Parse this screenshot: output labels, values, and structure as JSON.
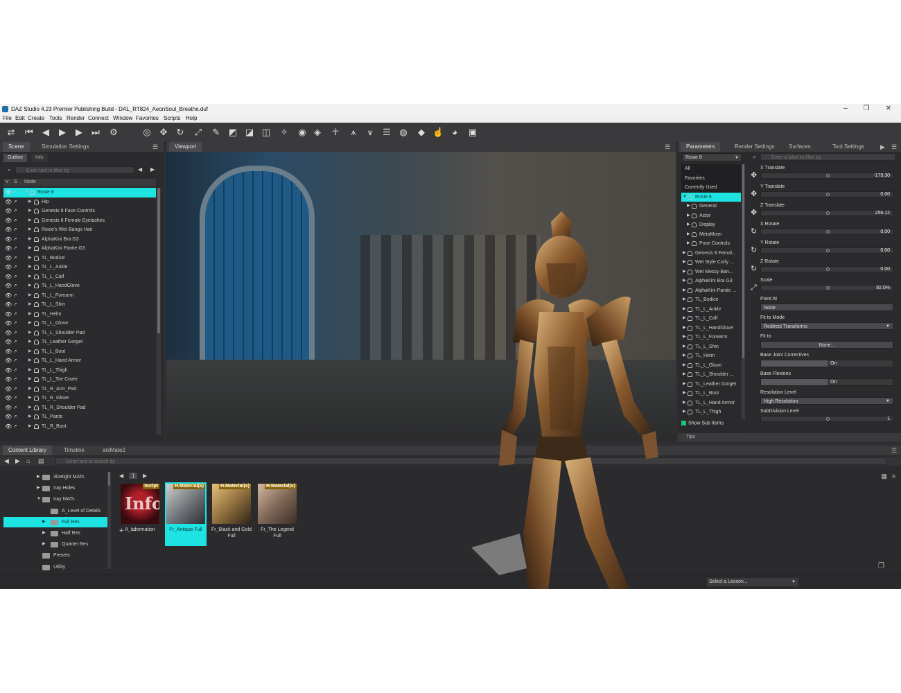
{
  "window": {
    "title": "DAZ Studio 4.23 Premier Publishing Build - DAL_RT824_AeonSoul_Breathe.duf",
    "controls": [
      "–",
      "❐",
      "✕"
    ]
  },
  "menu": [
    "File",
    "Edit",
    "Create",
    "Tools",
    "Render",
    "Connect",
    "Window",
    "Favorites",
    "Scripts",
    "Help"
  ],
  "toolbar": {
    "icons": [
      "undo-redo-icon",
      "skip-start-icon",
      "step-back-icon",
      "play-icon",
      "step-forward-icon",
      "skip-end-icon",
      "node-selection-icon",
      "universal-tool-icon",
      "translate-icon",
      "rotate-icon",
      "scale-icon",
      "joint-editor-icon",
      "geometry-editor-icon",
      "surface-selection-icon",
      "region-navigator-icon",
      "active-pose-icon",
      "camera-icon",
      "render-icon",
      "figure-icon",
      "morph-icon",
      "morph-alt-icon",
      "list-icon",
      "spot-render-icon",
      "iray-icon",
      "pointer-icon",
      "sphere-icon",
      "cube-icon"
    ]
  },
  "scene": {
    "tabs": [
      "Scene",
      "Simulation Settings"
    ],
    "subtabs": [
      "Outline",
      "Info"
    ],
    "filter_placeholder": "Enter text to filter by",
    "header": {
      "v": "V",
      "s": "S",
      "node": "Node"
    },
    "rows": [
      {
        "label": "Rosie 8",
        "level": 0,
        "selected": true
      },
      {
        "label": "Hip",
        "level": 1
      },
      {
        "label": "Genesis 8 Face Controls",
        "level": 1
      },
      {
        "label": "Genesis 8 Female Eyelashes",
        "level": 1
      },
      {
        "label": "Rosie's Wet Bangs Hair",
        "level": 1
      },
      {
        "label": "AlphaKini Bra G3",
        "level": 1
      },
      {
        "label": "AlphaKini Pantie G3",
        "level": 1
      },
      {
        "label": "TL_Bodice",
        "level": 1
      },
      {
        "label": "TL_L_Ankle",
        "level": 1
      },
      {
        "label": "TL_L_Calf",
        "level": 1
      },
      {
        "label": "TL_L_HandGlove",
        "level": 1
      },
      {
        "label": "TL_L_Forearm",
        "level": 1
      },
      {
        "label": "TL_L_Shin",
        "level": 1
      },
      {
        "label": "TL_Helm",
        "level": 1
      },
      {
        "label": "TL_L_Glove",
        "level": 1
      },
      {
        "label": "TL_L_Shoulder Pad",
        "level": 1
      },
      {
        "label": "TL_Leather Gorget",
        "level": 1
      },
      {
        "label": "TL_L_Boot",
        "level": 1
      },
      {
        "label": "TL_L_Hand Armor",
        "level": 1
      },
      {
        "label": "TL_L_Thigh",
        "level": 1
      },
      {
        "label": "TL_L_Toe Cover",
        "level": 1
      },
      {
        "label": "TL_R_Arm_Pad",
        "level": 1
      },
      {
        "label": "TL_R_Glove",
        "level": 1
      },
      {
        "label": "TL_R_Shoulder Pad",
        "level": 1
      },
      {
        "label": "TL_Pants",
        "level": 1
      },
      {
        "label": "TL_R_Boot",
        "level": 1
      }
    ]
  },
  "viewport": {
    "tab": "Viewport"
  },
  "parameters": {
    "tabs": [
      "Parameters",
      "Render Settings",
      "Surfaces",
      "Tool Settings"
    ],
    "node_select": "Rosie 8",
    "filter_placeholder": "Enter a label to filter by",
    "tree": [
      {
        "label": "All",
        "type": "cat"
      },
      {
        "label": "Favorites",
        "type": "cat"
      },
      {
        "label": "Currently Used",
        "type": "cat"
      },
      {
        "label": "Rosie 8",
        "type": "node",
        "selected": true,
        "level": 0
      },
      {
        "label": "General",
        "level": 1
      },
      {
        "label": "Actor",
        "level": 1
      },
      {
        "label": "Display",
        "level": 1
      },
      {
        "label": "MetaMixer",
        "level": 1
      },
      {
        "label": "Pose Controls",
        "level": 1
      },
      {
        "label": "Genesis 8 Femal...",
        "level": 0
      },
      {
        "label": "Wet Style Curly ...",
        "level": 0
      },
      {
        "label": "Wet Messy Ban...",
        "level": 0
      },
      {
        "label": "AlphaKini Bra G3",
        "level": 0
      },
      {
        "label": "AlphaKini Pantie ...",
        "level": 0
      },
      {
        "label": "TL_Bodice",
        "level": 0
      },
      {
        "label": "TL_L_Ankle",
        "level": 0
      },
      {
        "label": "TL_L_Calf",
        "level": 0
      },
      {
        "label": "TL_L_HandGlove",
        "level": 0
      },
      {
        "label": "TL_L_Forearm",
        "level": 0
      },
      {
        "label": "TL_L_Shin",
        "level": 0
      },
      {
        "label": "TL_Helm",
        "level": 0
      },
      {
        "label": "TL_L_Glove",
        "level": 0
      },
      {
        "label": "TL_L_Shoulder ...",
        "level": 0
      },
      {
        "label": "TL_Leather Gorget",
        "level": 0
      },
      {
        "label": "TL_L_Boot",
        "level": 0
      },
      {
        "label": "TL_L_Hand Armor",
        "level": 0
      },
      {
        "label": "TL_L_Thigh",
        "level": 0
      }
    ],
    "show_sub_items": "Show Sub Items",
    "properties": [
      {
        "label": "X Translate",
        "kind": "slider",
        "value": "-179.30",
        "icon": "translate"
      },
      {
        "label": "Y Translate",
        "kind": "slider",
        "value": "0.00",
        "icon": "translate"
      },
      {
        "label": "Z Translate",
        "kind": "slider",
        "value": "256.12",
        "icon": "translate"
      },
      {
        "label": "X Rotate",
        "kind": "slider",
        "value": "0.00",
        "icon": "rotate"
      },
      {
        "label": "Y Rotate",
        "kind": "slider",
        "value": "0.00",
        "icon": "rotate"
      },
      {
        "label": "Z Rotate",
        "kind": "slider",
        "value": "0.00",
        "icon": "rotate"
      },
      {
        "label": "Scale",
        "kind": "slider",
        "value": "92.0%",
        "icon": "scale"
      },
      {
        "label": "Point At",
        "kind": "field",
        "value": "None"
      },
      {
        "label": "Fit to Mode",
        "kind": "dropdown",
        "value": "Redirect Transforms"
      },
      {
        "label": "Fit to",
        "kind": "button",
        "value": "None..."
      },
      {
        "label": "Base Joint Correctives",
        "kind": "toggle",
        "value": "On"
      },
      {
        "label": "Base Flexions",
        "kind": "toggle",
        "value": "On"
      },
      {
        "label": "Resolution Level",
        "kind": "dropdown",
        "value": "High Resolution"
      },
      {
        "label": "SubDivision Level",
        "kind": "slider",
        "value": "1"
      }
    ],
    "tips": "Tips"
  },
  "content": {
    "tabs": [
      "Content Library",
      "Timeline",
      "aniMate2"
    ],
    "search_placeholder": "Enter text to search by",
    "tree": [
      {
        "label": "3Delight MATs",
        "indent": 1,
        "arrow": "▶"
      },
      {
        "label": "Iray Hides",
        "indent": 1,
        "arrow": "▶"
      },
      {
        "label": "Iray MATs",
        "indent": 1,
        "arrow": "▼"
      },
      {
        "label": "A_Level of Details",
        "indent": 2,
        "arrow": ""
      },
      {
        "label": "Full Res",
        "indent": 2,
        "arrow": "▶",
        "selected": true
      },
      {
        "label": "Half Res",
        "indent": 2,
        "arrow": "▶"
      },
      {
        "label": "Quarter Res",
        "indent": 2,
        "arrow": "▶"
      },
      {
        "label": "Presets",
        "indent": 1,
        "arrow": ""
      },
      {
        "label": "Utility",
        "indent": 1,
        "arrow": ""
      }
    ],
    "page": "1",
    "cards": [
      {
        "title": "A_Information",
        "badge": "Script",
        "thumb": "info"
      },
      {
        "title": "Fr_Antique Full",
        "badge": "H.Material(s)",
        "thumb": "armor-silver",
        "selected": true
      },
      {
        "title": "Fr_Black and Gold Full",
        "badge": "H.Material(s)",
        "thumb": "armor-gold"
      },
      {
        "title": "Fr_The Legend Full",
        "badge": "H.Material(s)",
        "thumb": "armor-bronze"
      }
    ]
  },
  "status": {
    "lesson": "Select a Lesson..."
  },
  "colors": {
    "selection": "#1ee3e3",
    "panel": "#2b2b2d",
    "toolbar": "#3a3a3c"
  }
}
